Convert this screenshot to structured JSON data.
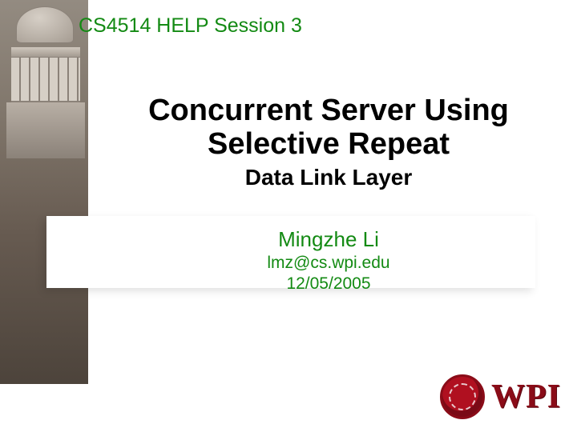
{
  "colors": {
    "accent_green": "#138a13",
    "wpi_maroon": "#8a0c18",
    "text_black": "#000000"
  },
  "header": {
    "session_label": "CS4514 HELP Session 3"
  },
  "title": {
    "line1": "Concurrent Server Using",
    "line2": "Selective Repeat",
    "subtitle": "Data Link Layer"
  },
  "presenter": {
    "name": "Mingzhe Li",
    "email": "lmz@cs.wpi.edu",
    "date": "12/05/2005"
  },
  "logo": {
    "text": "WPI",
    "seal_alt": "Worcester Polytechnic Institute seal"
  }
}
